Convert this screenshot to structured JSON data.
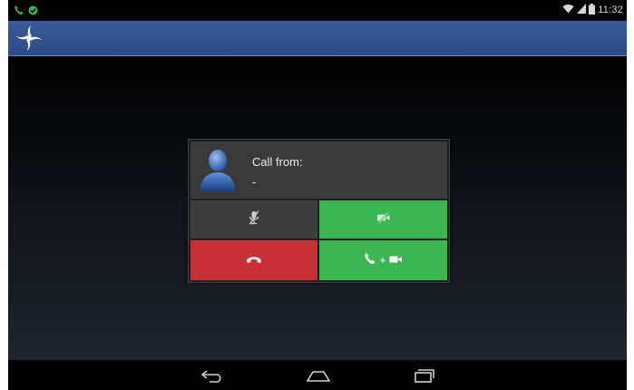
{
  "status_bar": {
    "time": "11:32",
    "icons": [
      "call-icon",
      "check-icon",
      "wifi-icon",
      "signal-icon",
      "battery-icon"
    ]
  },
  "app_bar": {
    "logo": "star-logo-icon",
    "color": "#2f4f8f"
  },
  "call_dialog": {
    "label": "Call from:",
    "caller": "-",
    "buttons": {
      "mute": {
        "icon": "mic-off-icon",
        "color": "#3d3d3d"
      },
      "video_off": {
        "icon": "video-off-icon",
        "color": "#3cb653"
      },
      "hangup": {
        "icon": "hangup-icon",
        "color": "#c83038"
      },
      "answer_video": {
        "icons": [
          "phone-icon",
          "video-icon"
        ],
        "plus": "+",
        "color": "#3cb653"
      }
    }
  },
  "nav_bar": {
    "icons": [
      "back-icon",
      "home-icon",
      "recents-icon"
    ]
  }
}
